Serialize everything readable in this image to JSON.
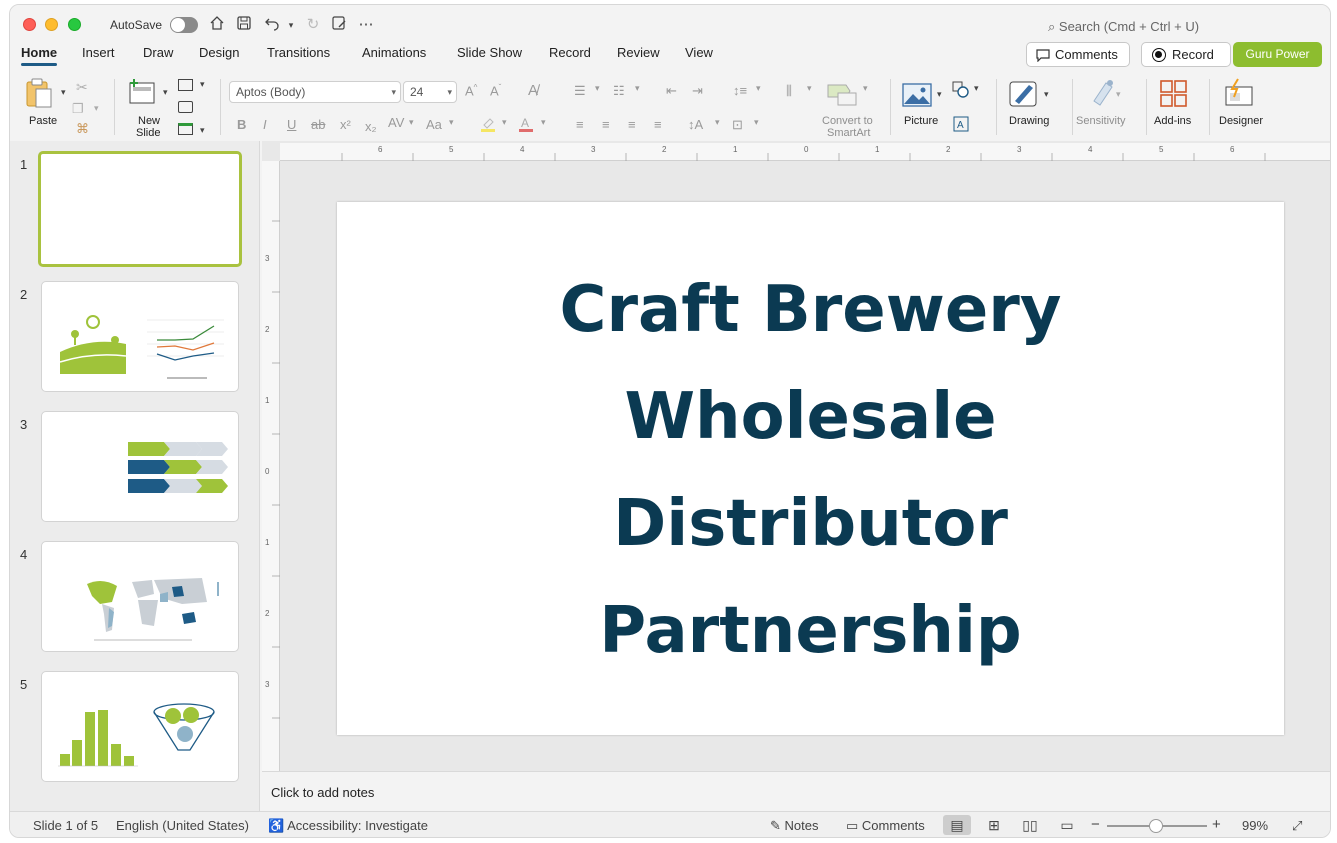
{
  "titlebar": {
    "autosave_label": "AutoSave",
    "search_placeholder": "Search (Cmd + Ctrl + U)"
  },
  "tabs": [
    {
      "label": "Home",
      "active": true
    },
    {
      "label": "Insert"
    },
    {
      "label": "Draw"
    },
    {
      "label": "Design"
    },
    {
      "label": "Transitions"
    },
    {
      "label": "Animations"
    },
    {
      "label": "Slide Show"
    },
    {
      "label": "Record"
    },
    {
      "label": "Review"
    },
    {
      "label": "View"
    }
  ],
  "actions": {
    "comments_label": "Comments",
    "record_label": "Record",
    "guru_label": "Guru Power"
  },
  "ribbon": {
    "paste_label": "Paste",
    "new_slide_label_1": "New",
    "new_slide_label_2": "Slide",
    "font_name": "Aptos (Body)",
    "font_size": "24",
    "convert_label_1": "Convert to",
    "convert_label_2": "SmartArt",
    "picture_label": "Picture",
    "drawing_label": "Drawing",
    "sensitivity_label": "Sensitivity",
    "addins_label": "Add-ins",
    "designer_label": "Designer"
  },
  "thumbnails": [
    {
      "number": "1"
    },
    {
      "number": "2"
    },
    {
      "number": "3"
    },
    {
      "number": "4"
    },
    {
      "number": "5"
    }
  ],
  "slide": {
    "title_lines": [
      "Craft Brewery",
      "Wholesale",
      "Distributor",
      "Partnership"
    ],
    "title_color": "#0b3a52"
  },
  "notes": {
    "placeholder": "Click to add notes"
  },
  "status": {
    "slide_position": "Slide 1 of 5",
    "language": "English (United States)",
    "accessibility": "Accessibility: Investigate",
    "notes_label": "Notes",
    "comments_label": "Comments",
    "zoom": "99%"
  },
  "colors": {
    "accent_green": "#8dbd2f",
    "tab_underline": "#1e5b86"
  }
}
